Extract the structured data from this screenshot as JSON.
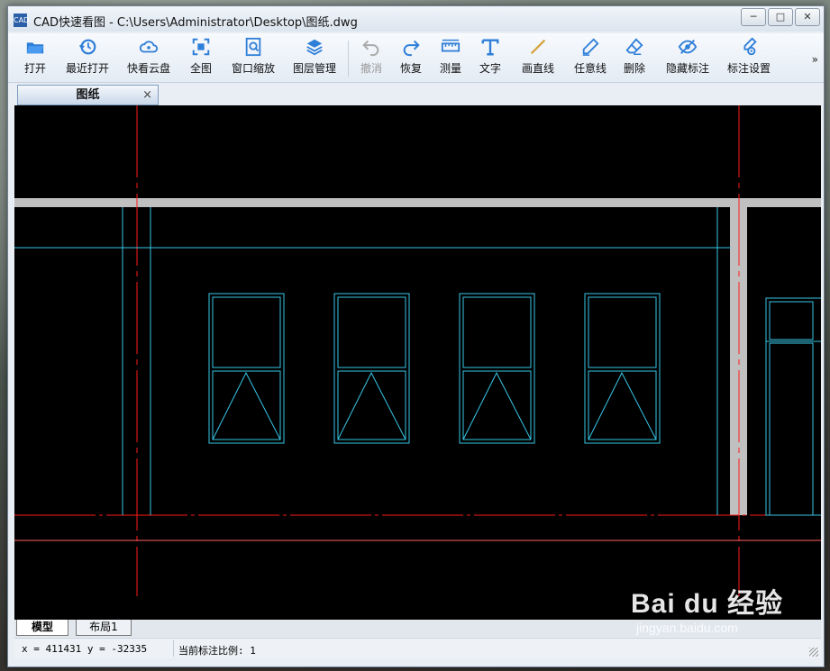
{
  "window": {
    "title": "CAD快速看图 - C:\\Users\\Administrator\\Desktop\\图纸.dwg",
    "app_icon_text": "CAD",
    "minimize": "─",
    "maximize": "□",
    "close": "✕"
  },
  "toolbar": {
    "items": [
      {
        "label": "打开",
        "icon": "folder-open-icon"
      },
      {
        "label": "最近打开",
        "icon": "recent-clock-icon"
      },
      {
        "label": "快看云盘",
        "icon": "cloud-icon"
      },
      {
        "label": "全图",
        "icon": "fit-all-icon"
      },
      {
        "label": "窗口缩放",
        "icon": "zoom-window-icon"
      },
      {
        "label": "图层管理",
        "icon": "layers-icon"
      },
      {
        "label": "撤消",
        "icon": "undo-icon"
      },
      {
        "label": "恢复",
        "icon": "redo-icon"
      },
      {
        "label": "测量",
        "icon": "ruler-icon"
      },
      {
        "label": "文字",
        "icon": "text-icon"
      },
      {
        "label": "画直线",
        "icon": "line-icon"
      },
      {
        "label": "任意线",
        "icon": "pen-icon"
      },
      {
        "label": "删除",
        "icon": "eraser-icon"
      },
      {
        "label": "隐藏标注",
        "icon": "eye-hide-icon"
      },
      {
        "label": "标注设置",
        "icon": "annotation-settings-icon"
      }
    ],
    "more": "»"
  },
  "doc_tab": {
    "label": "图纸",
    "close": "×"
  },
  "layout_tabs": {
    "model": "模型",
    "layout1": "布局1"
  },
  "status": {
    "coords": "x = 411431 y = -32335",
    "scale": "当前标注比例: 1"
  },
  "watermark": {
    "main": "Bai du 经验",
    "sub": "jingyan.baidu.com"
  },
  "colors": {
    "accent": "#2f7fd8",
    "cad_cyan": "#00e5ff",
    "cad_red": "#ff1a1a",
    "wall_grey": "#c0c0c0"
  }
}
